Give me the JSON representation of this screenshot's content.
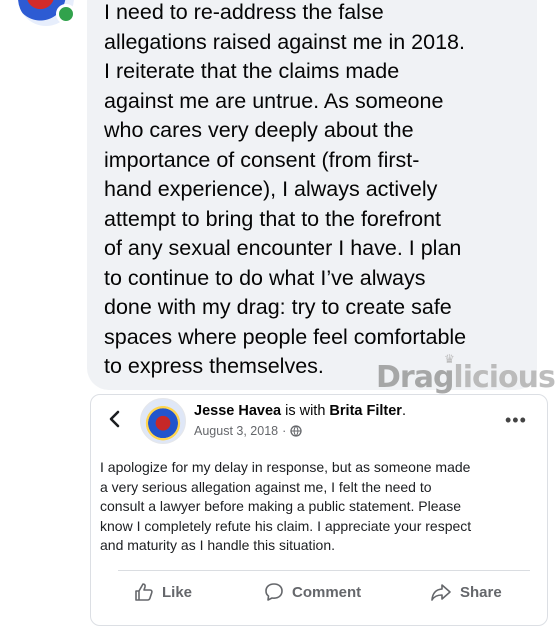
{
  "message": {
    "text": "I need to re-address the false\nallegations raised against me in 2018.\nI reiterate that the claims made\nagainst me are untrue. As someone\nwho cares very deeply about the\nimportance of consent (from first-\nhand experience), I always actively\nattempt to bring that to the forefront\nof any sexual encounter I have.  I plan\nto continue to do what I’ve always\ndone with my drag: try to create safe\nspaces where people feel comfortable\nto express themselves."
  },
  "watermark": {
    "part1": "Drag",
    "part2": "licious"
  },
  "post": {
    "author": "Jesse Havea",
    "with_text": " is with ",
    "tagged": "Brita Filter",
    "period": ".",
    "date": "August 3, 2018",
    "separator": "·",
    "privacy_icon": "globe-icon",
    "more_icon": "more-icon",
    "more_label": "•••",
    "body": "I apologize for my delay in response, but as someone made\na very serious allegation against me, I felt the need to\nconsult a lawyer before making a public statement. Please\nknow I completely refute his claim. I appreciate your respect\nand maturity as I handle this situation.",
    "actions": {
      "like": "Like",
      "comment": "Comment",
      "share": "Share"
    }
  },
  "colors": {
    "bubble": "#f0f2f5",
    "online": "#31a24c",
    "meta": "#65676b"
  }
}
